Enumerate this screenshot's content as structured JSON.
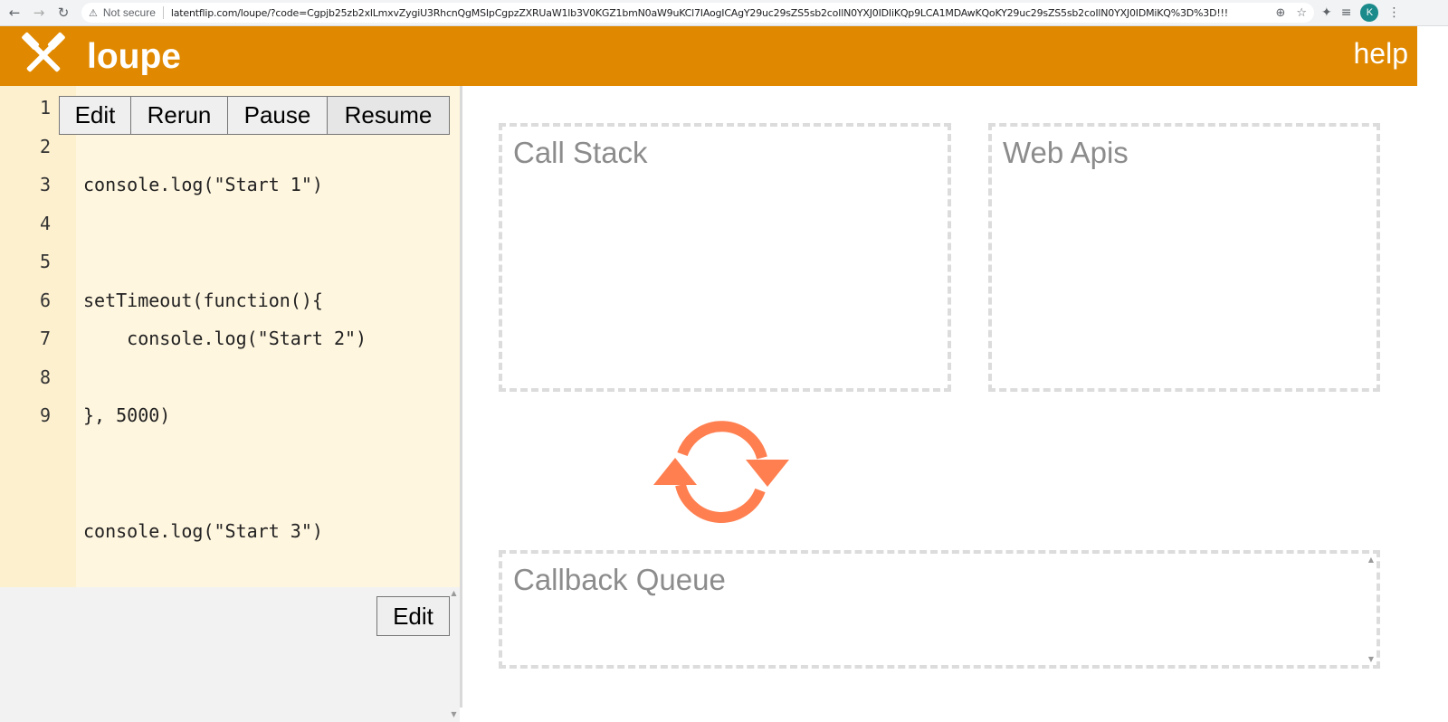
{
  "browser": {
    "back": "←",
    "forward": "→",
    "reload": "↻",
    "security_icon": "warning-triangle-icon",
    "security_label": "Not secure",
    "url": "latentflip.com/loupe/?code=Cgpjb25zb2xlLmxvZygiU3RhcnQgMSIpCgpzZXRUaW1lb3V0KGZ1bmN0aW9uKCl7IAogICAgY29uc29sZS5sb2coIlN0YXJ0IDIiKQp9LCA1MDAwKQoKY29uc29sZS5sb2coIlN0YXJ0IDMiKQ%3D%3D!!!",
    "profile_initial": "K"
  },
  "header": {
    "title": "loupe",
    "help": "help",
    "bg_color": "#e08900"
  },
  "toolbar": {
    "edit": "Edit",
    "rerun": "Rerun",
    "pause": "Pause",
    "resume": "Resume"
  },
  "editor": {
    "line_numbers": [
      "1",
      "2",
      "3",
      "4",
      "5",
      "6",
      "7",
      "8",
      "9"
    ],
    "lines": [
      "console.log(\"Start 1\")",
      "setTimeout(function(){",
      "    console.log(\"Start 2\")",
      "}, 5000)",
      "console.log(\"Start 3\")"
    ]
  },
  "console": {
    "edit": "Edit"
  },
  "panels": {
    "call_stack": "Call Stack",
    "web_apis": "Web Apis",
    "callback_queue": "Callback Queue"
  },
  "loop": {
    "icon": "event-loop-refresh-icon",
    "color": "#ff7f50"
  }
}
